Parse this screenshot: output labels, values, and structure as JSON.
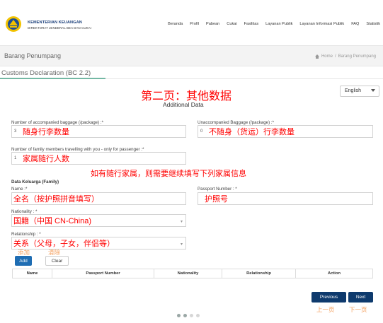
{
  "header": {
    "org_name": "KEMENTERIAN KEUANGAN",
    "org_sub": "DIREKTORAT JENDERAL BEA DAN CUKAI",
    "nav": [
      "Beranda",
      "Profil",
      "Pabean",
      "Cukai",
      "Fasilitas",
      "Layanan Publik",
      "Layanan Informasi Publik",
      "FAQ",
      "Statistik"
    ]
  },
  "breadcrumb": {
    "page_title": "Barang Penumpang",
    "home": "Home",
    "sep": "/",
    "current": "Barang Penumpang"
  },
  "section": {
    "title": "Customs Declaration (BC 2.2)"
  },
  "language": {
    "selected": "English"
  },
  "annotations": {
    "page_title": "第二页：其他数据",
    "accompanied": "随身行李数量",
    "unaccompanied": "不随身（货运）行李数量",
    "family_count": "家属随行人数",
    "family_note": "如有随行家属，则需要继续填写下列家属信息",
    "name": "全名（按护照拼音填写）",
    "passport": "护照号",
    "nationality": "国籍（中国 CN-China)",
    "relationship": "关系（父母，子女，伴侣等）",
    "add": "添加",
    "clear": "清除",
    "prev": "上一页",
    "next": "下一页"
  },
  "form": {
    "subtitle": "Additional Data",
    "accompanied_label": "Number of accompanied baggage (/package) :*",
    "accompanied_value": "3",
    "unaccompanied_label": "Unaccompanied Baggage (/package) :*",
    "unaccompanied_value": "0",
    "family_count_label": "Number of family members travelling with you - only for passenger :*",
    "family_count_value": "1",
    "family_section": "Data Keluarga (Family)",
    "name_label": "Name :*",
    "passport_label": "Passport Number : *",
    "nationality_label": "Nationality : *",
    "relationship_label": "Relationship : *",
    "add_button": "Add",
    "clear_button": "Clear"
  },
  "table": {
    "columns": [
      "Name",
      "Passport Number",
      "Nationality",
      "Relationship",
      "Action"
    ]
  },
  "pager": {
    "previous": "Previous",
    "next": "Next"
  }
}
